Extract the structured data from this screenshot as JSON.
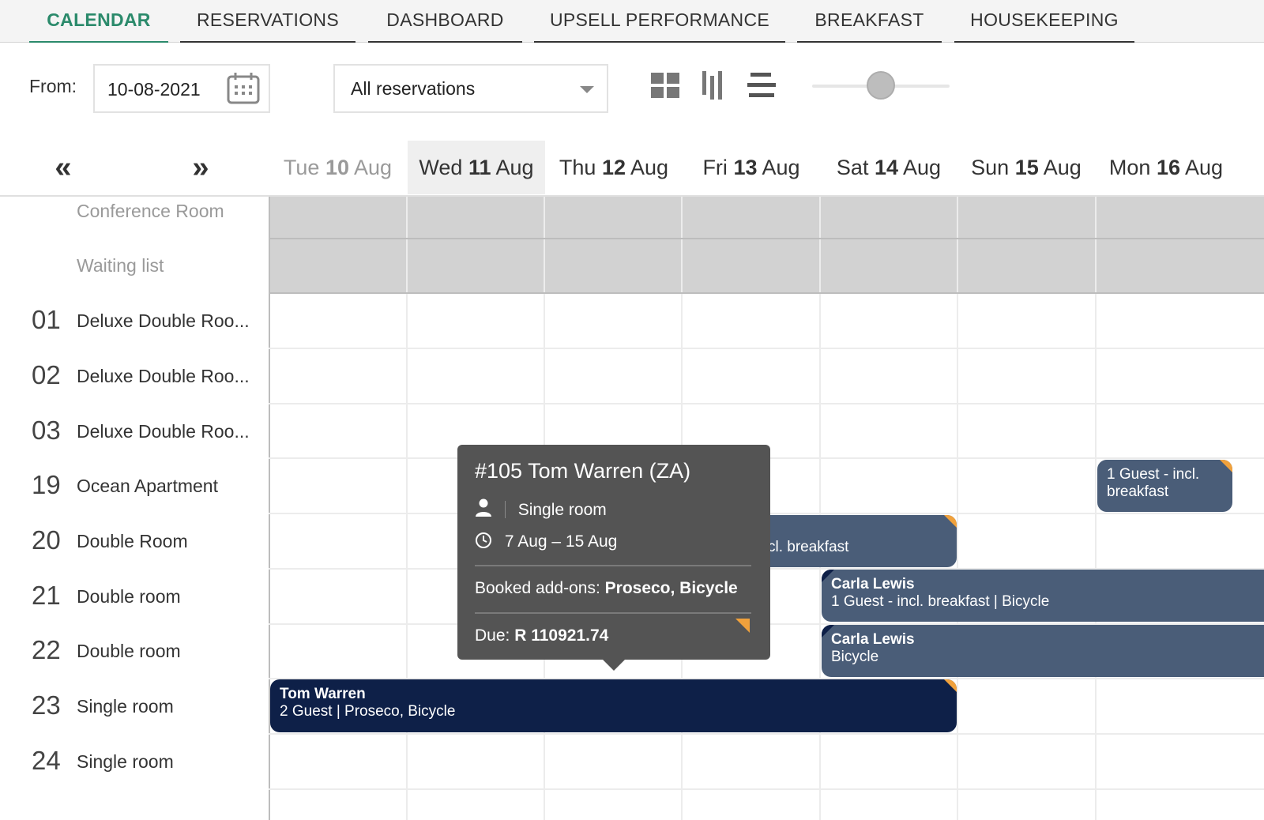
{
  "tabs": [
    {
      "label": "CALENDAR",
      "active": true
    },
    {
      "label": "RESERVATIONS"
    },
    {
      "label": "DASHBOARD"
    },
    {
      "label": "UPSELL PERFORMANCE"
    },
    {
      "label": "BREAKFAST"
    },
    {
      "label": "HOUSEKEEPING"
    }
  ],
  "toolbar": {
    "from_label": "From:",
    "from_date": "10-08-2021",
    "filter_value": "All reservations",
    "zoom_level": 0.5
  },
  "calendar": {
    "prev_icon": "double-chevron-left-icon",
    "next_icon": "double-chevron-right-icon",
    "days": [
      {
        "dow": "Tue",
        "num": "10",
        "mon": "Aug",
        "state": "past"
      },
      {
        "dow": "Wed",
        "num": "11",
        "mon": "Aug",
        "state": "today"
      },
      {
        "dow": "Thu",
        "num": "12",
        "mon": "Aug"
      },
      {
        "dow": "Fri",
        "num": "13",
        "mon": "Aug"
      },
      {
        "dow": "Sat",
        "num": "14",
        "mon": "Aug"
      },
      {
        "dow": "Sun",
        "num": "15",
        "mon": "Aug"
      },
      {
        "dow": "Mon",
        "num": "16",
        "mon": "Aug"
      }
    ],
    "rooms": [
      {
        "num": "",
        "name": "Conference Room"
      },
      {
        "num": "",
        "name": "Waiting list"
      },
      {
        "num": "01",
        "name": "Deluxe Double Roo..."
      },
      {
        "num": "02",
        "name": "Deluxe Double Roo..."
      },
      {
        "num": "03",
        "name": "Deluxe Double Roo..."
      },
      {
        "num": "19",
        "name": "Ocean Apartment"
      },
      {
        "num": "20",
        "name": "Double Room"
      },
      {
        "num": "21",
        "name": "Double room"
      },
      {
        "num": "22",
        "name": "Double room"
      },
      {
        "num": "23",
        "name": "Single room"
      },
      {
        "num": "24",
        "name": "Single room"
      }
    ],
    "bookings": [
      {
        "name": "",
        "detail": "1 Guest - incl. breakfast"
      },
      {
        "name": "",
        "detail": "cl. breakfast"
      },
      {
        "name": "Carla Lewis",
        "detail": "1 Guest - incl. breakfast | Bicycle"
      },
      {
        "name": "Carla Lewis",
        "detail": "Bicycle"
      },
      {
        "name": "Tom Warren",
        "detail": "2 Guest | Proseco, Bicycle"
      }
    ]
  },
  "tooltip": {
    "title": "#105 Tom Warren (ZA)",
    "room_type": "Single room",
    "dates": "7 Aug – 15 Aug",
    "addons_label": "Booked add-ons:",
    "addons_value": "Proseco, Bicycle",
    "due_label": "Due:",
    "due_value": "R 110921.74"
  },
  "colors": {
    "accent": "#2b8a6b",
    "booking_slate": "#4a5d78",
    "booking_navy": "#0e2048",
    "flag_orange": "#f0a13c",
    "tooltip_bg": "#545454"
  }
}
